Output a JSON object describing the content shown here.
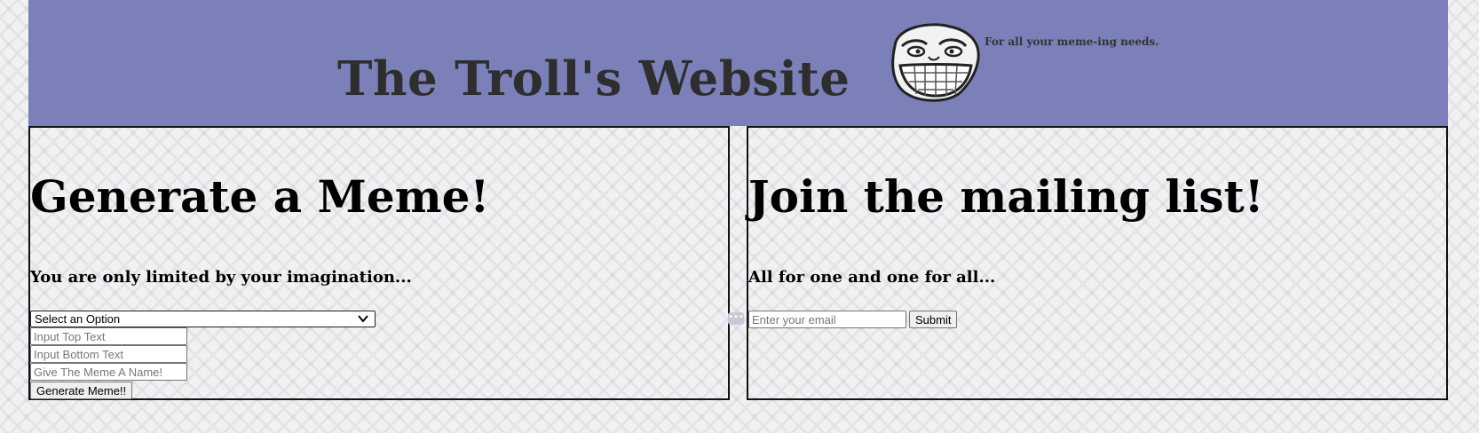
{
  "header": {
    "title": "The Troll's Website",
    "tagline": "For all your meme-ing needs."
  },
  "meme_panel": {
    "heading": "Generate a Meme!",
    "subheading": "You are only limited by your imagination...",
    "select_value": "Select an Option",
    "top_text_placeholder": "Input Top Text",
    "bottom_text_placeholder": "Input Bottom Text",
    "name_placeholder": "Give The Meme A Name!",
    "generate_button": "Generate Meme!!"
  },
  "mailing_panel": {
    "heading": "Join the mailing list!",
    "subheading": "All for one and one for all...",
    "email_placeholder": "Enter your email",
    "submit_button": "Submit"
  },
  "colors": {
    "header_bg": "#7c80b8",
    "title_text": "#2e2e2e"
  },
  "icons": {
    "header_image": "troll-face-icon",
    "select_arrow": "chevron-down-icon",
    "panel_divider_handle": "ellipsis-icon"
  }
}
